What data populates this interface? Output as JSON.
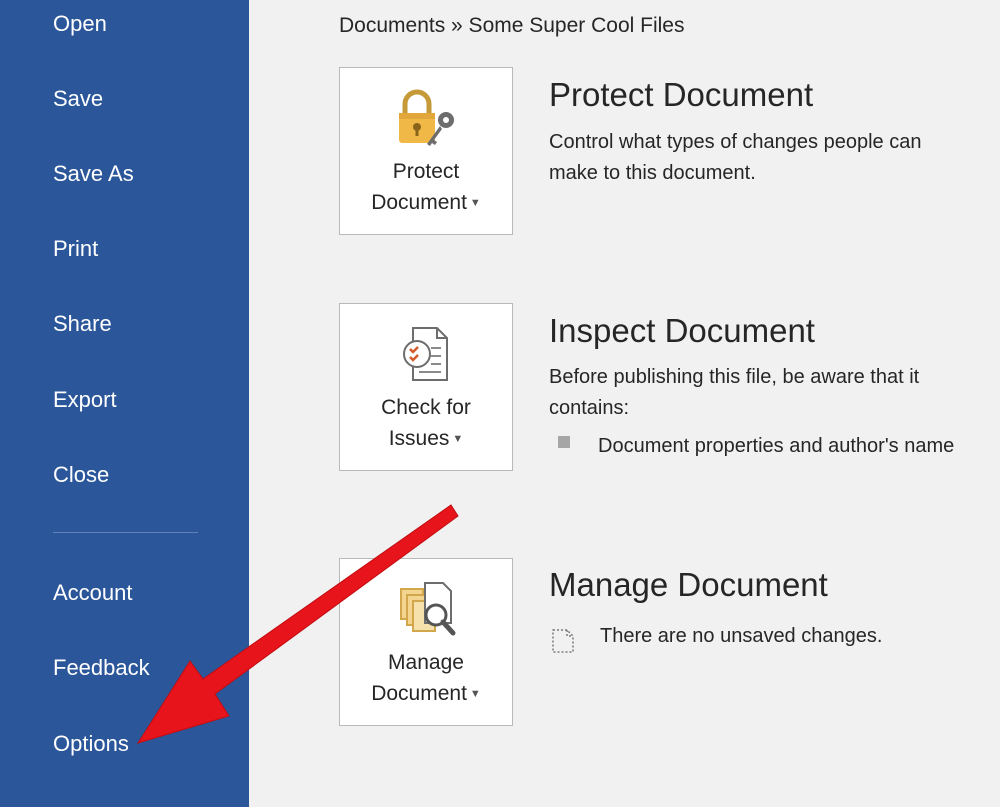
{
  "sidebar": {
    "items": [
      {
        "label": "Open"
      },
      {
        "label": "Save"
      },
      {
        "label": "Save As"
      },
      {
        "label": "Print"
      },
      {
        "label": "Share"
      },
      {
        "label": "Export"
      },
      {
        "label": "Close"
      }
    ],
    "bottom_items": [
      {
        "label": "Account"
      },
      {
        "label": "Feedback"
      },
      {
        "label": "Options"
      }
    ]
  },
  "breadcrumb": "Documents » Some Super Cool Files",
  "sections": {
    "protect": {
      "button_line1": "Protect",
      "button_line2": "Document",
      "title": "Protect Document",
      "description": "Control what types of changes people can make to this document.",
      "icon": "lock-key-icon"
    },
    "inspect": {
      "button_line1": "Check for",
      "button_line2": "Issues",
      "title": "Inspect Document",
      "description": "Before publishing this file, be aware that it contains:",
      "bullet": "Document properties and author's name",
      "icon": "checklist-icon"
    },
    "manage": {
      "button_line1": "Manage",
      "button_line2": "Document",
      "title": "Manage Document",
      "status": "There are no unsaved changes.",
      "icon": "documents-magnifier-icon"
    }
  },
  "colors": {
    "sidebar": "#2b579a",
    "background": "#f1f1f1",
    "arrow": "#e8141b"
  }
}
